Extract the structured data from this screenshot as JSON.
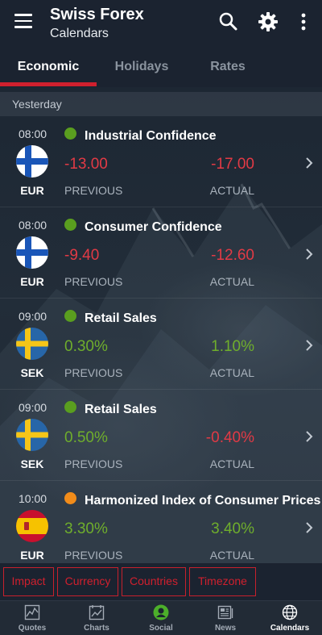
{
  "app": {
    "title": "Swiss Forex",
    "subtitle": "Calendars"
  },
  "icons": {
    "menu": "hamburger-menu-icon",
    "search": "search-icon",
    "settings": "gear-icon",
    "more": "more-vertical-icon"
  },
  "tabs": [
    {
      "label": "Economic",
      "active": true
    },
    {
      "label": "Holidays",
      "active": false
    },
    {
      "label": "Rates",
      "active": false
    }
  ],
  "section": {
    "label": "Yesterday"
  },
  "events": [
    {
      "time": "08:00",
      "currency": "EUR",
      "flag": "finland",
      "impact": "green",
      "name": "Industrial Confidence",
      "previous": "-13.00",
      "actual": "-17.00",
      "previous_label": "PREVIOUS",
      "actual_label": "ACTUAL",
      "previous_tone": "negative",
      "actual_tone": "negative"
    },
    {
      "time": "08:00",
      "currency": "EUR",
      "flag": "finland",
      "impact": "green",
      "name": "Consumer Confidence",
      "previous": "-9.40",
      "actual": "-12.60",
      "previous_label": "PREVIOUS",
      "actual_label": "ACTUAL",
      "previous_tone": "negative",
      "actual_tone": "negative"
    },
    {
      "time": "09:00",
      "currency": "SEK",
      "flag": "sweden",
      "impact": "green",
      "name": "Retail Sales",
      "previous": "0.30%",
      "actual": "1.10%",
      "previous_label": "PREVIOUS",
      "actual_label": "ACTUAL",
      "previous_tone": "positive",
      "actual_tone": "positive"
    },
    {
      "time": "09:00",
      "currency": "SEK",
      "flag": "sweden",
      "impact": "green",
      "name": "Retail Sales",
      "previous": "0.50%",
      "actual": "-0.40%",
      "previous_label": "PREVIOUS",
      "actual_label": "ACTUAL",
      "previous_tone": "positive",
      "actual_tone": "negative"
    },
    {
      "time": "10:00",
      "currency": "EUR",
      "flag": "spain",
      "impact": "orange",
      "name": "Harmonized Index of Consumer Prices",
      "previous": "3.30%",
      "actual": "3.40%",
      "previous_label": "PREVIOUS",
      "actual_label": "ACTUAL",
      "previous_tone": "positive",
      "actual_tone": "positive"
    }
  ],
  "filters": [
    "Impact",
    "Currency",
    "Countries",
    "Timezone"
  ],
  "bottom_nav": [
    {
      "label": "Quotes",
      "icon": "quotes-chart-icon",
      "active": false
    },
    {
      "label": "Charts",
      "icon": "charts-icon",
      "active": false
    },
    {
      "label": "Social",
      "icon": "social-user-icon",
      "active": false
    },
    {
      "label": "News",
      "icon": "news-icon",
      "active": false
    },
    {
      "label": "Calendars",
      "icon": "globe-icon",
      "active": true
    }
  ],
  "colors": {
    "accent": "#d0202e",
    "negative": "#e23a45",
    "positive": "#6fae2c",
    "impact_green": "#5a9e1f",
    "impact_orange": "#f28c1a"
  }
}
